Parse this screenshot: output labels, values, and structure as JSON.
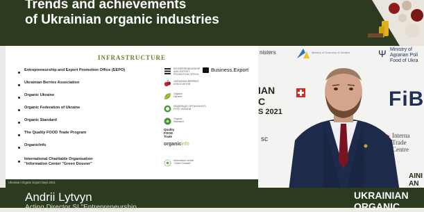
{
  "banner": {
    "title_line1": "Trends and achievements",
    "title_line2": "of Ukrainian organic industries"
  },
  "backdrop": {
    "ministers": "nisters",
    "eco_ministry": "Ministry of Economy of Ukraine",
    "ministry_agri": "Ministry of\nAgrarian Poli\nFood of Ukra",
    "big_text": "IAN\nC",
    "year": "S 2021",
    "fibl": "FiBL",
    "sc": "sc",
    "itc": "Interna\nTrade\nCentre",
    "side": "AINI\nAN"
  },
  "slide": {
    "heading": "INFRASTRUCTURE",
    "footer": "Ukrainian Organic Export Days 2021",
    "items": [
      {
        "label": "Entrepreneurship and Export Promotion Office (EEPO)",
        "logo_text": "ENTREPRENEURSHIP AND EXPORT PROMOTION OFFICE",
        "extra": "Business.Export"
      },
      {
        "label": "Ukrainian Berries Association",
        "logo_text": "UKRAINIAN BERRIES ASSOCIATION"
      },
      {
        "label": "Organic Ukraine",
        "logo_text": "Organic\nUkraine"
      },
      {
        "label": "Organic Federation of Ukraine",
        "logo_text": "ФЕДЕРАЦІЯ ОРГАНІЧНОГО\nРУХУ УКРАЇНИ"
      },
      {
        "label": "Organic Standard",
        "logo_text": "Organic\nStandard"
      },
      {
        "label": "The Quality FOOD Trade Program",
        "logo_text": "Quality\nFOOD\nTrade"
      },
      {
        "label": "OrganicInfo",
        "logo_text": "organic",
        "logo_text2": "info"
      },
      {
        "label": "International Charitable Organisation\n\"Information Center \"Green Dossier\"",
        "logo_text": "Information centre\n\"Green Dossier\""
      }
    ]
  },
  "lower_third": {
    "name": "Andrii Lytvyn",
    "role": "Acting Director SI \"Entrepreneurship",
    "brand": "UKRAINIAN\nORGANIC"
  },
  "colors": {
    "banner_bg": "#2c3a1f",
    "heading_olive": "#6b7a2e",
    "fibl_blue": "#1e3056"
  }
}
